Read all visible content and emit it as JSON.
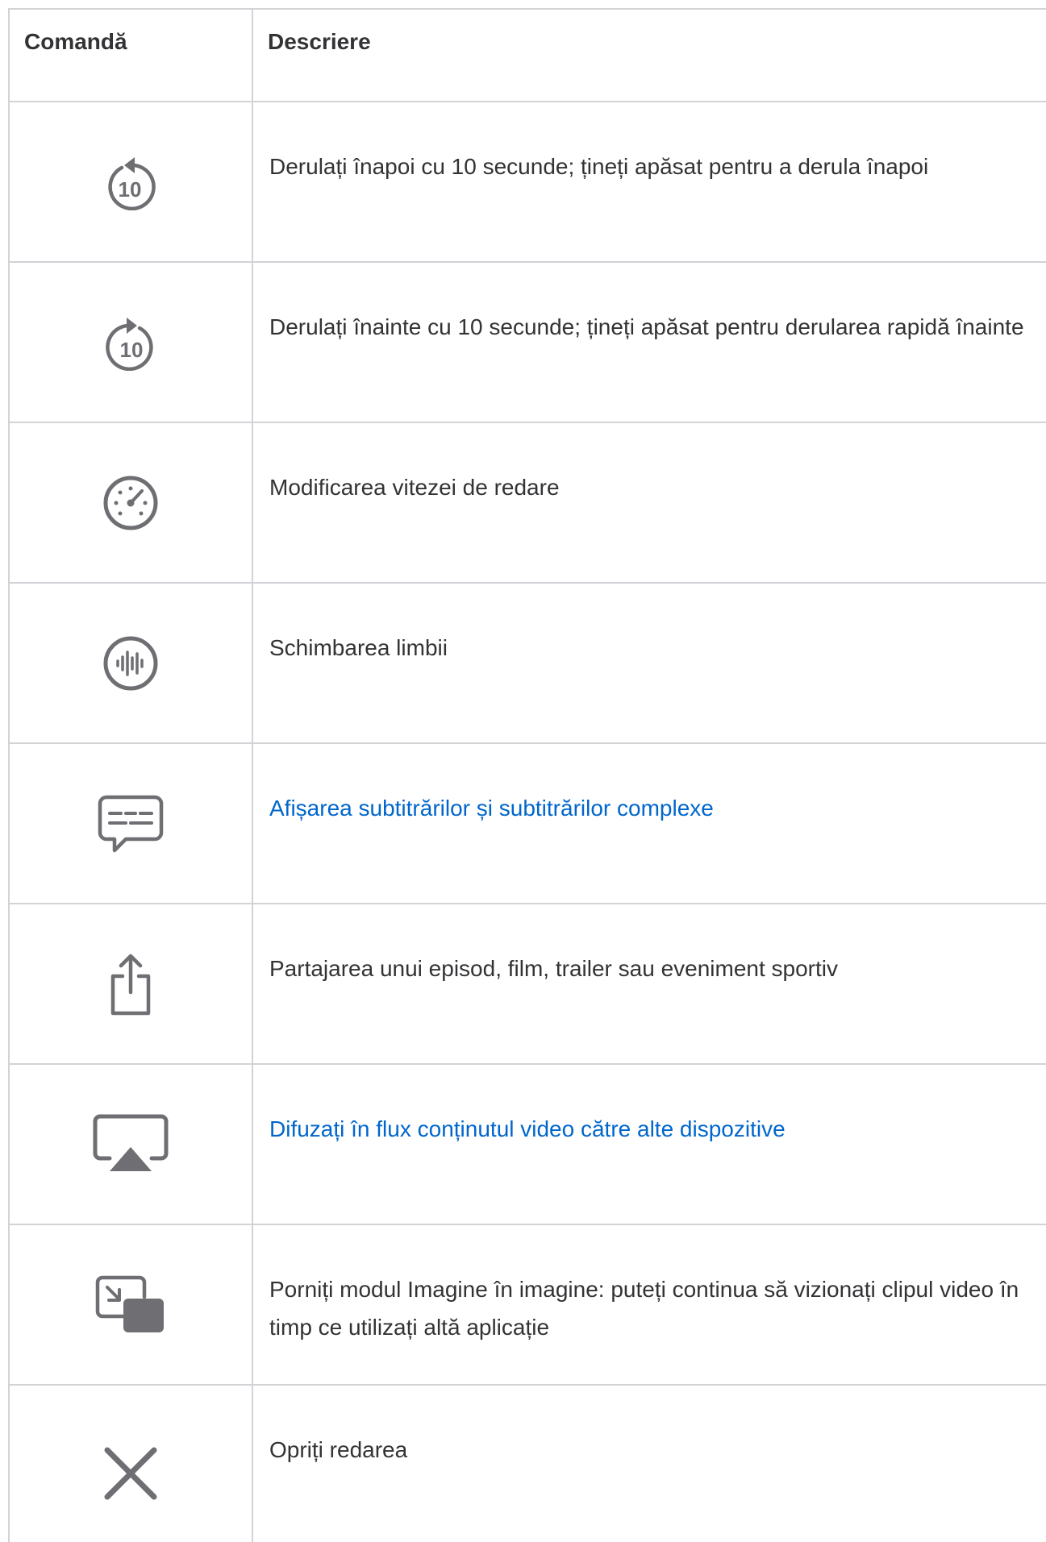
{
  "table": {
    "header": {
      "command": "Comandă",
      "description": "Descriere"
    },
    "rows": [
      {
        "icon": "skip-back-10-icon",
        "description": "Derulați înapoi cu 10 secunde; țineți apăsat pentru a derula înapoi",
        "is_link": false
      },
      {
        "icon": "skip-forward-10-icon",
        "description": "Derulați înainte cu 10 secunde; țineți apăsat pentru derularea rapidă înainte",
        "is_link": false
      },
      {
        "icon": "playback-speed-icon",
        "description": "Modificarea vitezei de redare",
        "is_link": false
      },
      {
        "icon": "audio-language-icon",
        "description": "Schimbarea limbii",
        "is_link": false
      },
      {
        "icon": "subtitles-icon",
        "description": "Afișarea subtitrărilor și subtitrărilor complexe",
        "is_link": true
      },
      {
        "icon": "share-icon",
        "description": "Partajarea unui episod, film, trailer sau eveniment sportiv",
        "is_link": false
      },
      {
        "icon": "airplay-icon",
        "description": "Difuzați în flux conținutul video către alte dispozitive",
        "is_link": true
      },
      {
        "icon": "picture-in-picture-icon",
        "description": "Porniți modul Imagine în imagine: puteți continua să vizionați clipul video în timp ce utilizați altă aplicație",
        "is_link": false
      },
      {
        "icon": "close-icon",
        "description": "Opriți redarea",
        "is_link": false
      }
    ]
  },
  "colors": {
    "text": "#333336",
    "link": "#0066cc",
    "icon": "#6e6e73",
    "border": "#d2d2d7"
  }
}
